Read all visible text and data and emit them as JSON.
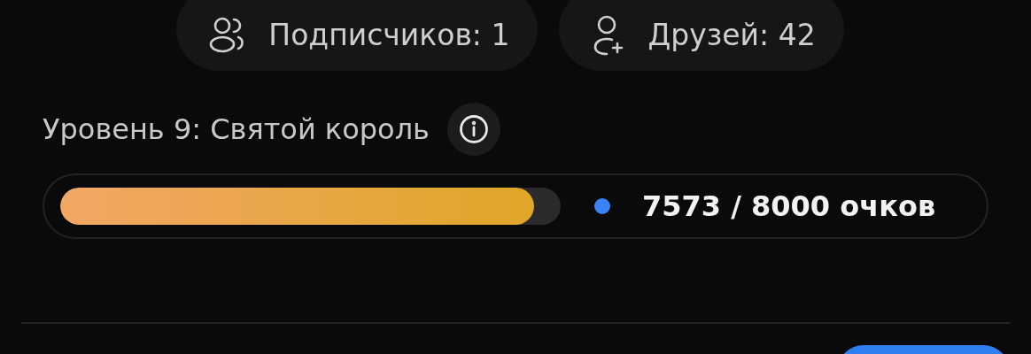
{
  "stats": [
    {
      "kind": "followers",
      "label": "Подписчиков: 1"
    },
    {
      "kind": "friends",
      "label": "Друзей: 42"
    }
  ],
  "level": {
    "title": "Уровень 9: Святой король",
    "progress": {
      "level": 0.947,
      "color": "#3b82f6",
      "reading": "7573 / 8000 очков"
    }
  }
}
